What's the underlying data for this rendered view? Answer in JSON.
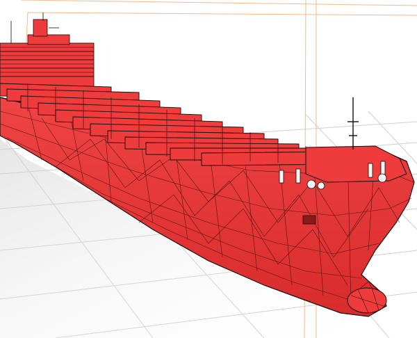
{
  "scene": {
    "subject": "container-ship-wireframe-model",
    "colors": {
      "background": "#ffffff",
      "hull_fill": "#ee3b3b",
      "hull_shadow": "#c92626",
      "wireframe": "#1a0a0a",
      "ground_grid": "#cfcfcf",
      "ground_shadow": "#d9d9d9",
      "bounding_box": "#f2b98a"
    }
  }
}
